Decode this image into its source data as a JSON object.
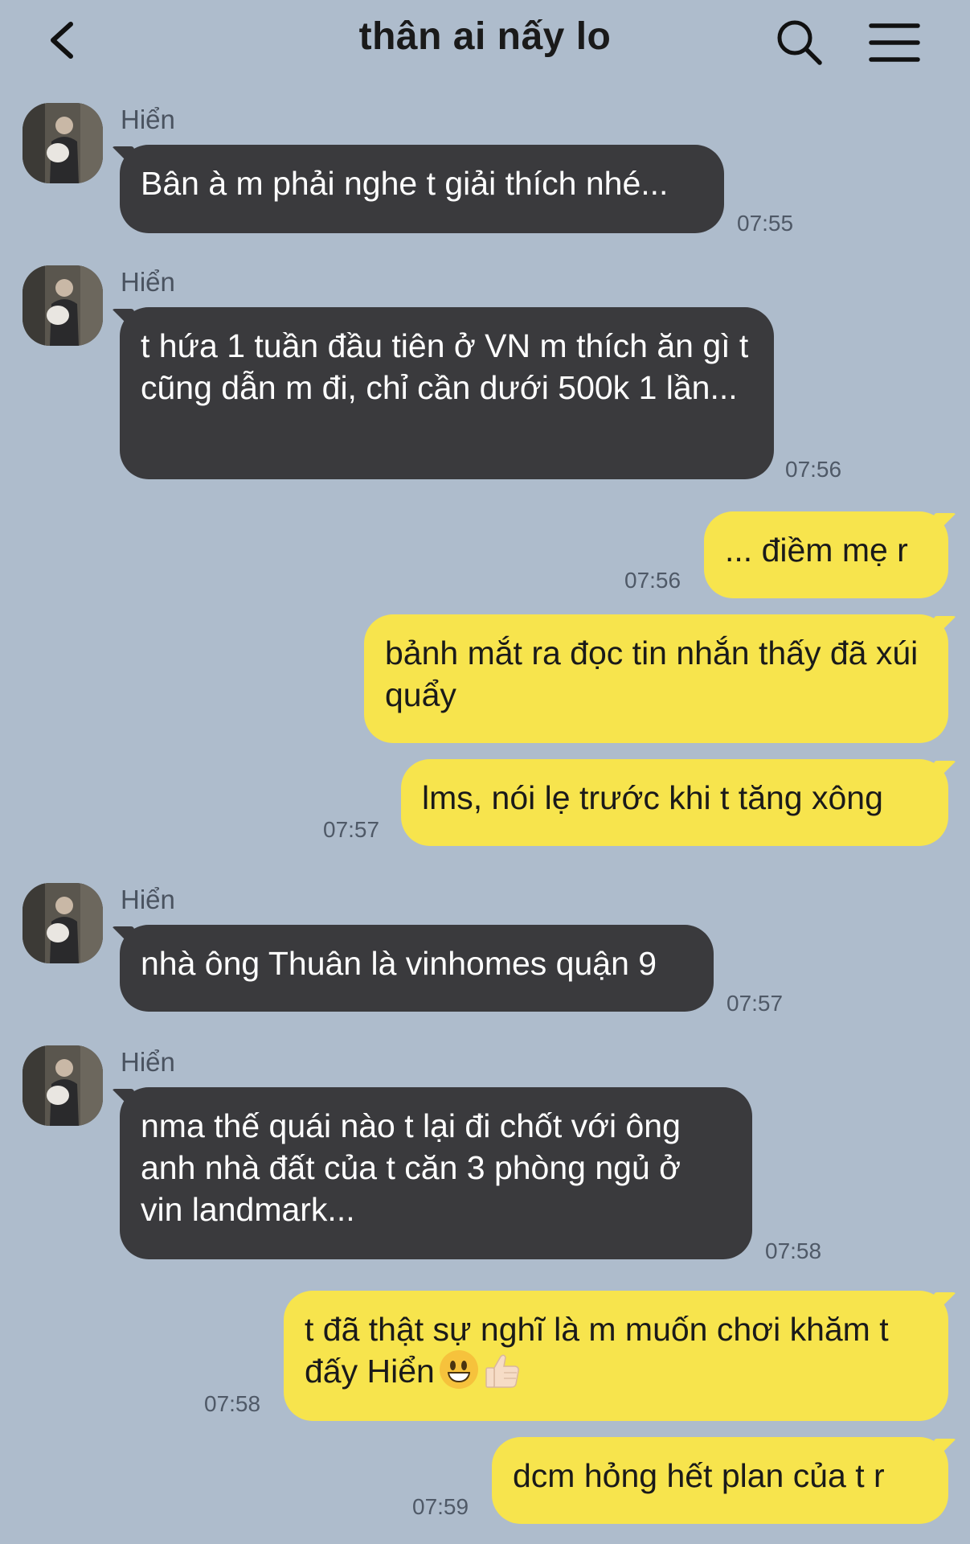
{
  "header": {
    "title": "thân ai nấy lo"
  },
  "icons": {
    "back": "chevron-left-icon",
    "search": "search-icon",
    "menu": "hamburger-menu-icon"
  },
  "colors": {
    "background": "#aebccc",
    "incoming_bubble": "#3a3a3d",
    "outgoing_bubble": "#f7e44d"
  },
  "messages": [
    {
      "direction": "in",
      "sender": "Hiển",
      "text": "Bân à m phải nghe t giải thích nhé...",
      "time": "07:55"
    },
    {
      "direction": "in",
      "sender": "Hiển",
      "text": "t hứa 1 tuần đầu tiên ở VN m thích ăn gì t cũng dẫn m đi, chỉ cần dưới 500k 1 lần...",
      "time": "07:56"
    },
    {
      "direction": "out",
      "text": "... điềm mẹ r",
      "time": "07:56"
    },
    {
      "direction": "out",
      "text": "bảnh mắt ra đọc tin nhắn thấy đã xúi quẩy",
      "time": ""
    },
    {
      "direction": "out",
      "text": "lms, nói lẹ trước khi t tăng xông",
      "time": "07:57"
    },
    {
      "direction": "in",
      "sender": "Hiển",
      "text": "nhà ông Thuân là vinhomes quận 9",
      "time": "07:57"
    },
    {
      "direction": "in",
      "sender": "Hiển",
      "text": "nma thế quái nào t lại đi chốt với ông anh nhà đất của t căn 3 phòng ngủ ở vin landmark...",
      "time": "07:58"
    },
    {
      "direction": "out",
      "text": "t đã thật sự nghĩ là m muốn chơi khăm t đấy Hiển",
      "emojis": [
        "grinning-face-emoji",
        "thumbs-up-emoji"
      ],
      "time": "07:58"
    },
    {
      "direction": "out",
      "text": "dcm hỏng hết plan của t r",
      "time": "07:59"
    }
  ]
}
